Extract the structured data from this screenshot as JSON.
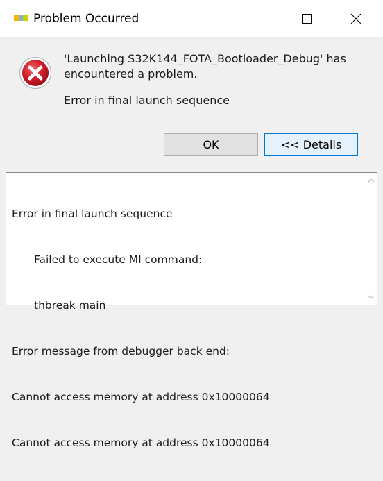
{
  "window": {
    "title": "Problem Occurred",
    "app_icon": "nxp-logo-icon",
    "controls": [
      "minimize-icon",
      "maximize-icon",
      "close-icon"
    ]
  },
  "dialog": {
    "icon": "error-icon",
    "message": "'Launching S32K144_FOTA_Bootloader_Debug' has encountered a problem.",
    "detail_summary": "Error in final launch sequence",
    "ok_label": "OK",
    "details_label": "<< Details"
  },
  "details": {
    "lines": [
      {
        "text": "Error in final launch sequence",
        "indent": false
      },
      {
        "text": "Failed to execute MI command:",
        "indent": true
      },
      {
        "text": "thbreak main",
        "indent": true
      },
      {
        "text": "Error message from debugger back end:",
        "indent": false
      },
      {
        "text": "Cannot access memory at address 0x10000064",
        "indent": false
      },
      {
        "text": "Cannot access memory at address 0x10000064",
        "indent": false
      }
    ]
  },
  "colors": {
    "error_red": "#d21f2b",
    "focus_border": "#0078d7",
    "nxp_yellow": "#f9b500",
    "nxp_blue": "#7bb1db",
    "nxp_green": "#c9d200"
  }
}
